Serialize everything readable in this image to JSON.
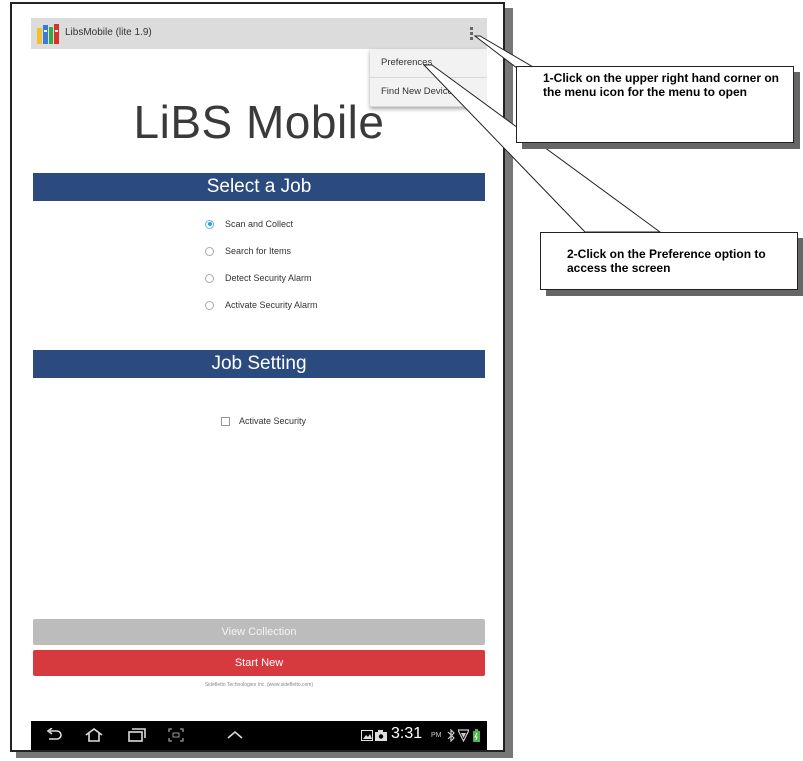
{
  "app": {
    "title": "LibsMobile (lite 1.9)",
    "logo_icon": "books-icon"
  },
  "menu": {
    "items": [
      "Preferences",
      "Find New Device"
    ]
  },
  "main": {
    "title": "LiBS Mobile",
    "select_job": {
      "heading": "Select a Job",
      "options": [
        {
          "label": "Scan and Collect",
          "selected": true
        },
        {
          "label": "Search for Items",
          "selected": false
        },
        {
          "label": "Detect Security Alarm",
          "selected": false
        },
        {
          "label": "Activate Security Alarm",
          "selected": false
        }
      ]
    },
    "job_setting": {
      "heading": "Job Setting",
      "activate_security_label": "Activate Security",
      "activate_security_checked": false
    },
    "view_collection_label": "View Collection",
    "start_new_label": "Start New",
    "footer": "Sidefletto Technologies Inc. (www.sidefletto.com)"
  },
  "status_bar": {
    "time": "3:31",
    "ampm": "PM"
  },
  "callouts": [
    {
      "text": "1-Click on the upper right hand corner on the menu icon for the menu to open"
    },
    {
      "text": "2-Click on the Preference option to access the screen"
    }
  ],
  "colors": {
    "section_bar": "#2b4b7e",
    "start_button": "#d63a3f",
    "radio_selected": "#2e9fd8"
  }
}
